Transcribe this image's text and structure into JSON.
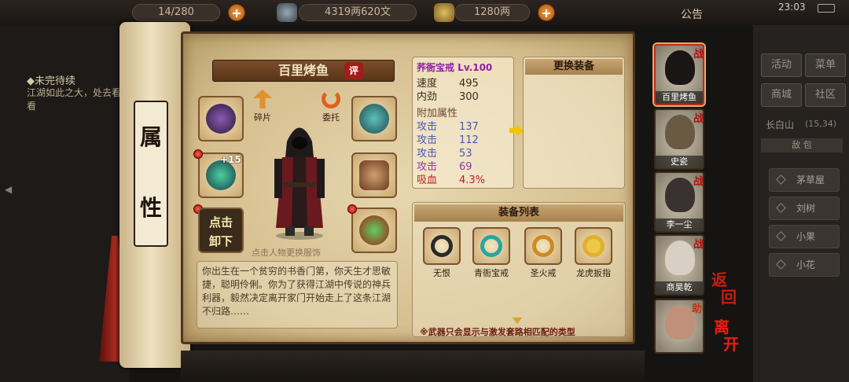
{
  "topbar": {
    "stamina": "14/280",
    "silver": "4319两620文",
    "gold": "1280两",
    "notice": "公告",
    "time": "23:03",
    "colors": {
      "accent": "#e07a20"
    }
  },
  "quest": {
    "title": "◆未完待续",
    "text": "江湖如此之大，处去看看"
  },
  "scroll": {
    "label_line1": "属",
    "label_line2": "性"
  },
  "character": {
    "name": "百里烤鱼",
    "eval_label": "评",
    "fragment_label": "碎片",
    "delegate_label": "委托",
    "enhance_level": "+15",
    "unequip_label_1": "点击",
    "unequip_label_2": "卸下",
    "hint": "点击人物更换服饰",
    "bio": "你出生在一个贫穷的书香门第，你天生才思敏捷，聪明伶俐。你为了获得江湖中传说的神兵利器，毅然决定离开家门开始走上了这条江湖不归路……"
  },
  "item": {
    "name": "荞衙宝戒 Lv.100",
    "base_stats": [
      {
        "key": "速度",
        "value": "495"
      },
      {
        "key": "内劲",
        "value": "300"
      }
    ],
    "extra_title": "附加属性",
    "extra_stats": [
      {
        "key": "攻击",
        "value": "137"
      },
      {
        "key": "攻击",
        "value": "112"
      },
      {
        "key": "攻击",
        "value": "53"
      },
      {
        "key": "攻击",
        "value": "69"
      },
      {
        "key": "吸血",
        "value": "4.3%"
      }
    ]
  },
  "change_title": "更换装备",
  "list": {
    "title": "装备列表",
    "items": [
      {
        "name": "无恨"
      },
      {
        "name": "青衙宝戒"
      },
      {
        "name": "圣火戒"
      },
      {
        "name": "龙虎扳指"
      }
    ],
    "note": "※武器只会显示与激发套路相匹配的类型"
  },
  "party": {
    "battle_tag": "战",
    "assist_tag": "助",
    "members": [
      {
        "name": "百里烤鱼"
      },
      {
        "name": "史瓷"
      },
      {
        "name": "李一尘"
      },
      {
        "name": "商昊乾"
      },
      {
        "name": ""
      }
    ]
  },
  "menu": {
    "activity": "活动",
    "menu": "菜单",
    "shop": "商城",
    "community": "社区",
    "location": "长白山",
    "coords": "(15,34)",
    "tab": "敌 包",
    "npcs": [
      "茅草屋",
      "刘树",
      "小果",
      "小花"
    ]
  },
  "actions": {
    "return_1": "返",
    "return_2": "回",
    "leave_1": "离",
    "leave_2": "开"
  }
}
